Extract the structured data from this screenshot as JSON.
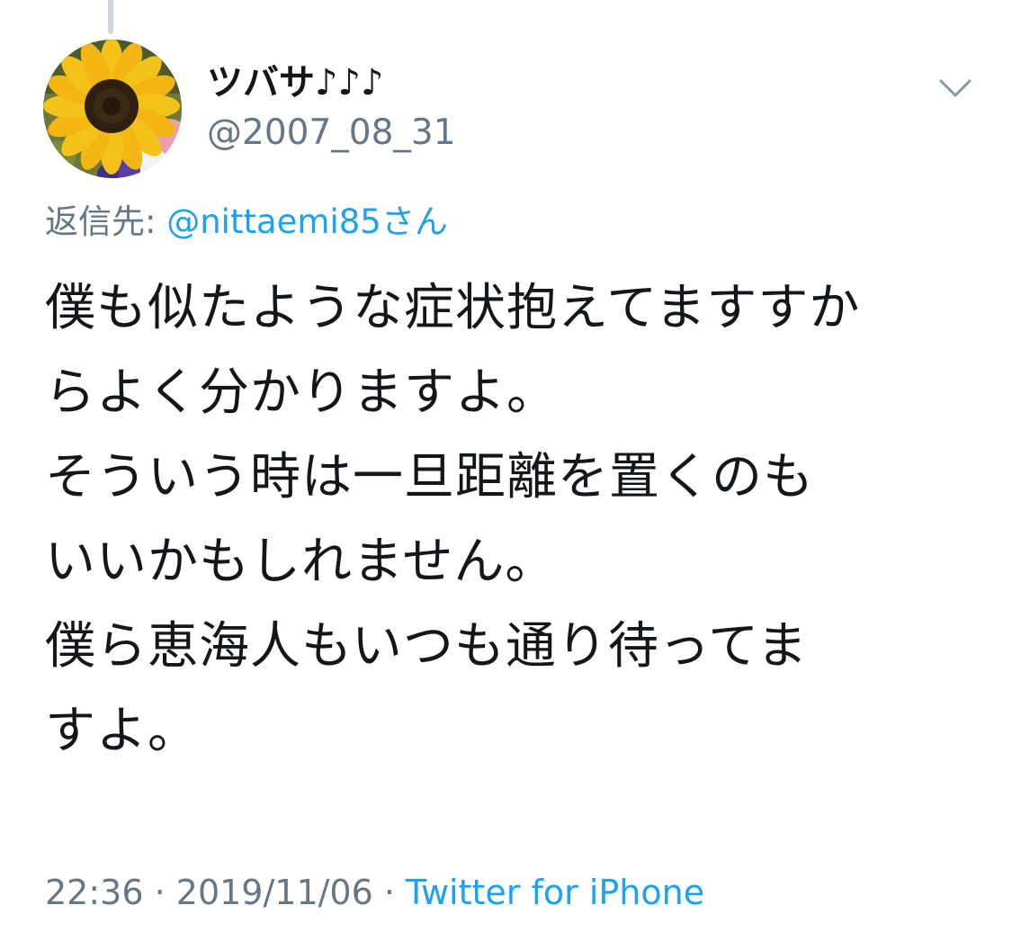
{
  "tweet": {
    "author": {
      "display_name": "ツバサ♪♪♪",
      "handle": "@2007_08_31",
      "avatar": "sunflower-avatar"
    },
    "menu_icon": "chevron-down-icon",
    "reply": {
      "label": "返信先: ",
      "mention": "@nittaemi85さん"
    },
    "body_lines": [
      "僕も似たような症状抱えてますすか",
      "らよく分かりますよ。",
      "そういう時は一旦距離を置くのも",
      "いいかもしれません。",
      "僕ら恵海人もいつも通り待ってま",
      "すよ。"
    ],
    "meta": {
      "time": "22:36",
      "separator": " · ",
      "date": "2019/11/06",
      "source": "Twitter for iPhone"
    }
  },
  "colors": {
    "text": "#14171a",
    "secondary": "#657786",
    "link": "#1da1f2",
    "thread_line": "#ccd6dd"
  }
}
